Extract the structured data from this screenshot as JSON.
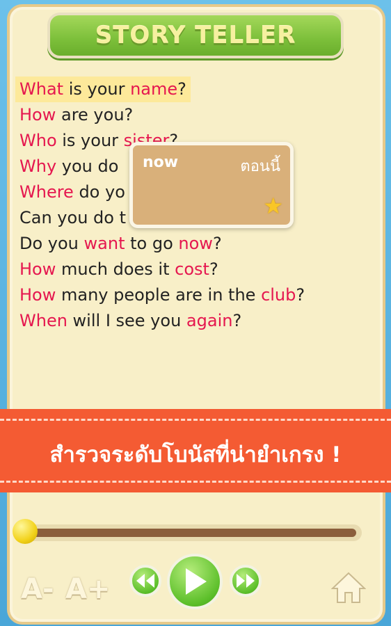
{
  "header": {
    "title": "STORY TELLER"
  },
  "sentences": [
    {
      "pre": "",
      "w1": "What",
      "mid": " is your ",
      "w2": "name",
      "post": "?"
    },
    {
      "pre": "",
      "w1": "How",
      "mid": " are you?",
      "w2": "",
      "post": ""
    },
    {
      "pre": "",
      "w1": "Who",
      "mid": " is your ",
      "w2": "sister",
      "post": "?"
    },
    {
      "pre": "",
      "w1": "Why",
      "mid": " you do",
      "w2": "",
      "post": ""
    },
    {
      "pre": "",
      "w1": "Where",
      "mid": " do yo",
      "w2": "",
      "post": ""
    },
    {
      "pre": "Can you do t",
      "w1": "",
      "mid": "",
      "w2": "",
      "post": ""
    },
    {
      "pre": "Do you ",
      "w1": "want",
      "mid": " to go ",
      "w2": "now",
      "post": "?"
    },
    {
      "pre": "",
      "w1": "How",
      "mid": " much does it ",
      "w2": "cost",
      "post": "?"
    },
    {
      "pre": "",
      "w1": "How",
      "mid": " many people are in the ",
      "w2": "club",
      "post": "?"
    },
    {
      "pre": "",
      "w1": "When",
      "mid": " will I see you ",
      "w2": "again",
      "post": "?"
    }
  ],
  "popup": {
    "word": "now",
    "translation": "ตอนนี้",
    "icon": "star-icon"
  },
  "banner": {
    "text": "สำรวจระดับโบนัสที่น่ายำเกรง !"
  },
  "controls": {
    "font_smaller": "A-",
    "font_larger": "A+",
    "rewind_icon": "rewind-icon",
    "play_icon": "play-icon",
    "forward_icon": "fast-forward-icon",
    "home_icon": "home-icon",
    "progress": 0.0
  },
  "colors": {
    "highlight_word": "#e5174f",
    "active_line_bg": "#fde99a",
    "banner": "#f45b33",
    "title_green": "#7cbf3a"
  }
}
